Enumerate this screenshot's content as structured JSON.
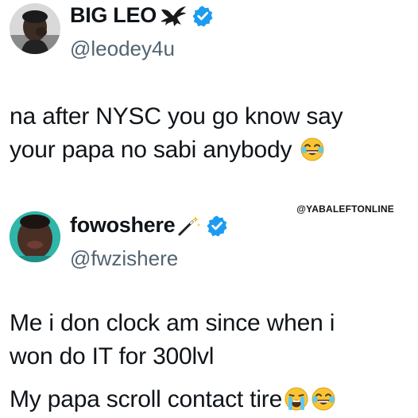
{
  "tweets": [
    {
      "display_name": "BIG LEO",
      "handle": "@leodey4u",
      "name_suffix_icon": "eagle-icon",
      "verified": true,
      "text_lines": [
        "na after NYSC you go know say",
        "your papa no sabi anybody"
      ],
      "trailing_emojis": [
        "face-with-tears-of-joy-emoji"
      ]
    },
    {
      "display_name": "fowoshere",
      "handle": "@fwzishere",
      "name_suffix_icon": "magic-wand-icon",
      "verified": true,
      "text_lines": [
        "Me i don clock am since when i",
        "won do IT for 300lvl",
        "My papa scroll contact tire"
      ],
      "trailing_emojis": [
        "loudly-crying-face-emoji",
        "face-with-tears-of-joy-emoji"
      ]
    }
  ],
  "watermark": "@YABALEFTONLINE",
  "colors": {
    "verified_blue": "#1d9bf0",
    "handle_gray": "#536471",
    "text": "#0f1419"
  }
}
